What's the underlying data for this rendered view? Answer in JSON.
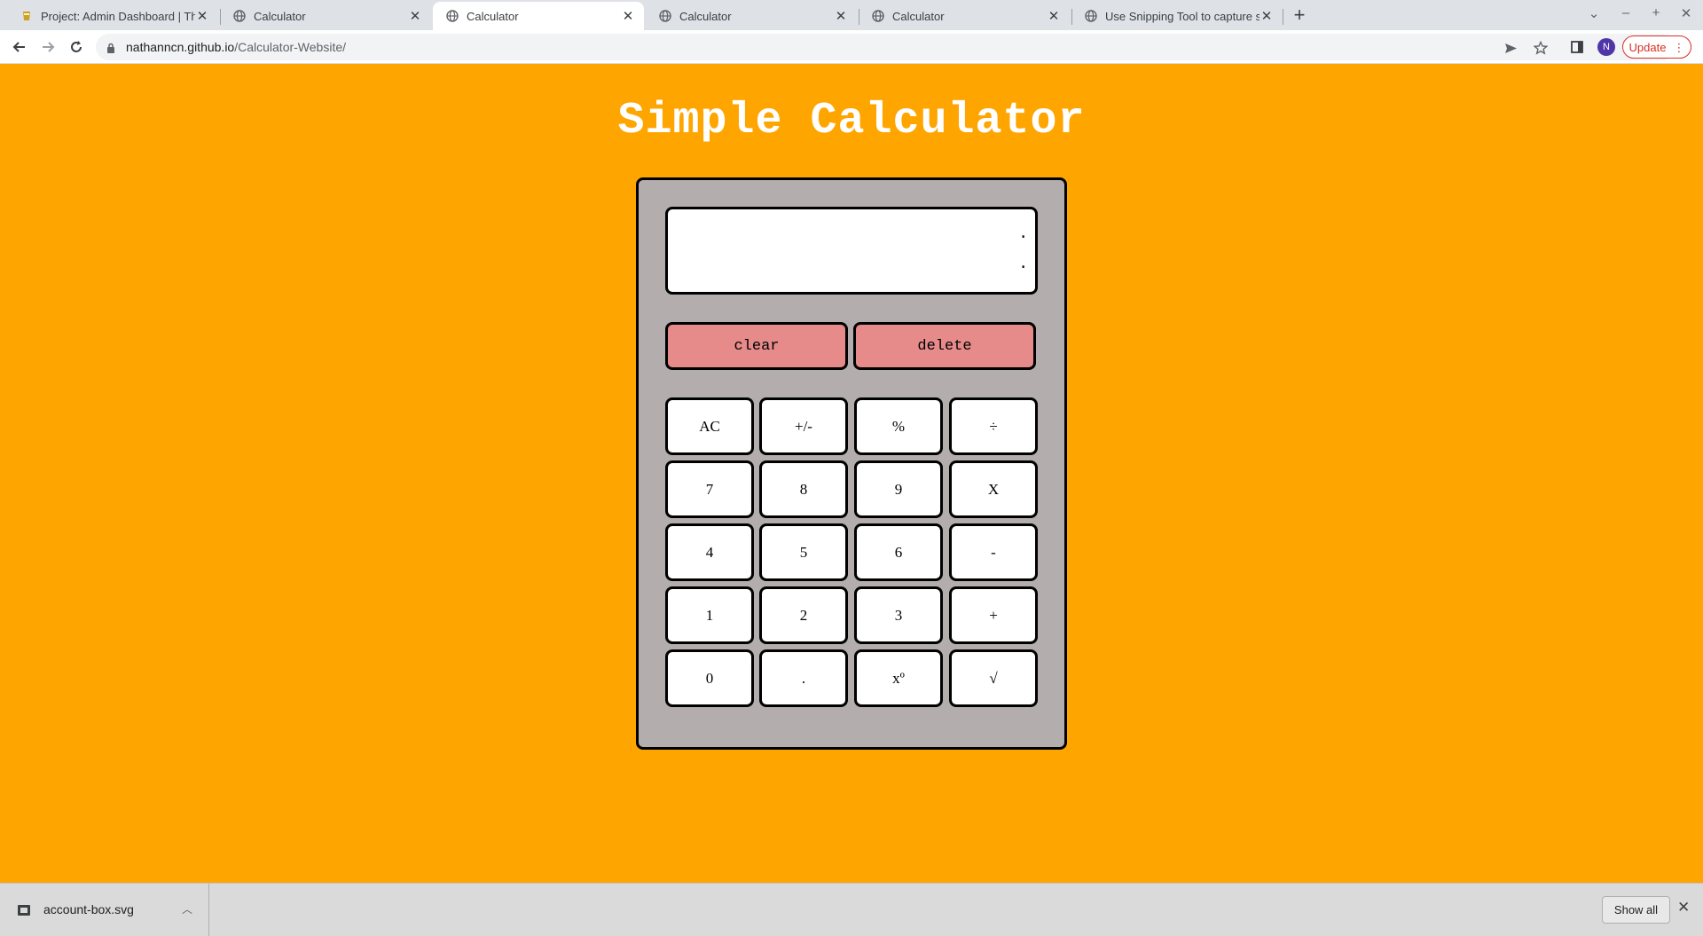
{
  "browser": {
    "tabs": [
      {
        "title": "Project: Admin Dashboard | Th",
        "icon": "odin-icon",
        "active": false
      },
      {
        "title": "Calculator",
        "icon": "globe-icon",
        "active": false
      },
      {
        "title": "Calculator",
        "icon": "globe-icon",
        "active": true
      },
      {
        "title": "Calculator",
        "icon": "globe-icon",
        "active": false
      },
      {
        "title": "Calculator",
        "icon": "globe-icon",
        "active": false
      },
      {
        "title": "Use Snipping Tool to capture sc",
        "icon": "globe-icon",
        "active": false
      }
    ],
    "url_host": "nathanncn.github.io",
    "url_path": "/Calculator-Website/",
    "profile_initial": "N",
    "update_label": "Update",
    "accent_color": "#d93025"
  },
  "page": {
    "title": "Simple Calculator",
    "background_color": "#ffa500"
  },
  "calculator": {
    "display": {
      "previous": ".",
      "current": "."
    },
    "clear_label": "clear",
    "delete_label": "delete",
    "keys": [
      [
        "AC",
        "+/-",
        "%",
        "÷"
      ],
      [
        "7",
        "8",
        "9",
        "X"
      ],
      [
        "4",
        "5",
        "6",
        "-"
      ],
      [
        "1",
        "2",
        "3",
        "+"
      ],
      [
        "0",
        ".",
        "xº",
        "√"
      ]
    ],
    "body_color": "#b3adad",
    "action_button_color": "#e68a8a"
  },
  "downloads": {
    "file_name": "account-box.svg",
    "show_all_label": "Show all"
  }
}
